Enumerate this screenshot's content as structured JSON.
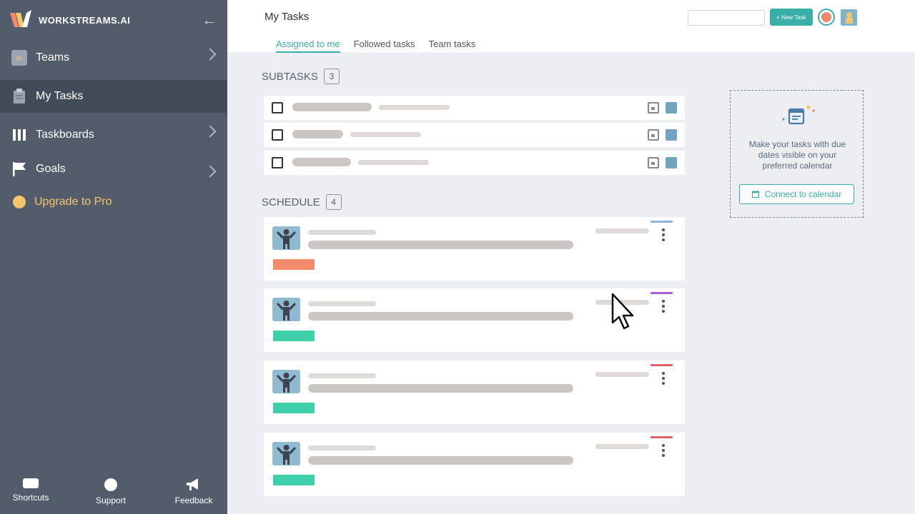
{
  "brand": {
    "name": "WORKSTREAMS.AI"
  },
  "sidebar": {
    "items": [
      {
        "label": "Teams",
        "icon": "team-icon"
      },
      {
        "label": "My Tasks",
        "icon": "clipboard-icon",
        "active": true
      },
      {
        "label": "Taskboards",
        "icon": "columns-icon"
      },
      {
        "label": "Goals",
        "icon": "flag-icon"
      },
      {
        "label": "Upgrade to Pro",
        "icon": "upgrade-dot-icon"
      }
    ],
    "bottom": [
      {
        "label": "Shortcuts",
        "icon": "keyboard-icon"
      },
      {
        "label": "Support",
        "icon": "support-icon"
      },
      {
        "label": "Feedback",
        "icon": "megaphone-icon"
      }
    ]
  },
  "header": {
    "title": "My Tasks",
    "new_task_label": "+ New Task",
    "tabs": [
      {
        "label": "Assigned to me",
        "active": true
      },
      {
        "label": "Followed tasks"
      },
      {
        "label": "Team tasks"
      }
    ]
  },
  "subtasks": {
    "title": "SUBTASKS",
    "count": "3"
  },
  "schedule": {
    "title": "SCHEDULE",
    "count": "4",
    "cards": [
      {
        "tag_color": "#f28b6e",
        "priority_color": "#8fb0d8"
      },
      {
        "tag_color": "#3fcfaa",
        "priority_color": "#a45ed6"
      },
      {
        "tag_color": "#3fcfaa",
        "priority_color": "#e0606e"
      },
      {
        "tag_color": "#3fcfaa",
        "priority_color": "#e0606e"
      }
    ]
  },
  "calendar_promo": {
    "text": "Make your tasks with due dates visible on your preferred calendar",
    "button_label": "Connect to calendar"
  },
  "colors": {
    "accent": "#3aafa9",
    "sidebar": "#525c6b",
    "upgrade": "#f5c56a"
  }
}
